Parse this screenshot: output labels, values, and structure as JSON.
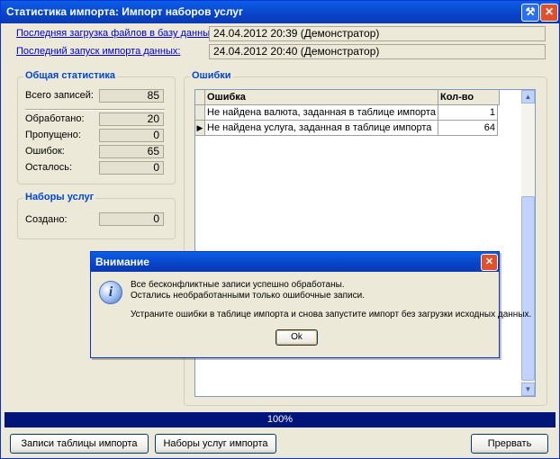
{
  "window": {
    "title": "Статистика импорта: Импорт наборов услуг",
    "wrench_icon": "wrench-icon",
    "close_icon": "close-icon"
  },
  "info": {
    "last_upload_label": "Последняя загрузка файлов в базу данных:",
    "last_upload_value": "24.04.2012 20:39 (Демонстратор)",
    "last_import_label": "Последний запуск импорта данных:",
    "last_import_value": "24.04.2012 20:40 (Демонстратор)"
  },
  "stats": {
    "title": "Общая статистика",
    "rows": [
      {
        "label": "Всего записей:",
        "value": "85"
      },
      {
        "label": "Обработано:",
        "value": "20"
      },
      {
        "label": "Пропущено:",
        "value": "0"
      },
      {
        "label": "Ошибок:",
        "value": "65"
      },
      {
        "label": "Осталось:",
        "value": "0"
      }
    ]
  },
  "sets": {
    "title": "Наборы услуг",
    "created_label": "Создано:",
    "created_value": "0"
  },
  "errors": {
    "title": "Ошибки",
    "columns": [
      "Ошибка",
      "Кол-во"
    ],
    "rows": [
      {
        "error": "Не найдена валюта, заданная в таблице импорта",
        "count": "1"
      },
      {
        "error": "Не найдена услуга, заданная в таблице импорта",
        "count": "64"
      }
    ],
    "current_row_marker": "▶"
  },
  "progress": {
    "text": "100%",
    "value": 1.0
  },
  "buttons": {
    "import_table": "Записи таблицы импорта",
    "import_sets": "Наборы услуг импорта",
    "abort": "Прервать"
  },
  "dialog": {
    "title": "Внимание",
    "icon": "info-icon",
    "icon_glyph": "i",
    "line1": "Все бесконфликтные записи успешно обработаны.",
    "line2": "Остались необработанными только ошибочные записи.",
    "line3": "Устраните ошибки в таблице импорта и снова запустите импорт без загрузки исходных данных.",
    "ok": "Ok"
  },
  "colors": {
    "titlebar": "#0843c8",
    "group_title": "#0046d5",
    "link": "#0000cc",
    "progress": "#00157a"
  }
}
